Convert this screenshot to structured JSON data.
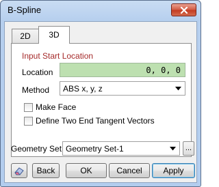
{
  "window": {
    "title": "B-Spline",
    "close_icon": "close-icon"
  },
  "tabs": [
    {
      "label": "2D",
      "active": false
    },
    {
      "label": "3D",
      "active": true
    }
  ],
  "panel": {
    "section_title": "Input Start Location",
    "location": {
      "label": "Location",
      "value": "0, 0, 0"
    },
    "method": {
      "label": "Method",
      "value": "ABS x, y, z"
    },
    "checkboxes": [
      {
        "label": "Make Face",
        "checked": false
      },
      {
        "label": "Define Two End Tangent Vectors",
        "checked": false
      }
    ]
  },
  "geometry_set": {
    "label": "Geometry Set",
    "value": "Geometry Set-1",
    "browse_label": "..."
  },
  "buttons": {
    "icon": "eraser-icon",
    "back": "Back",
    "ok": "OK",
    "cancel": "Cancel",
    "apply": "Apply"
  },
  "colors": {
    "section_title": "#a52a2a",
    "location_field": "#bde0b0",
    "close_button": "#c33c22"
  }
}
